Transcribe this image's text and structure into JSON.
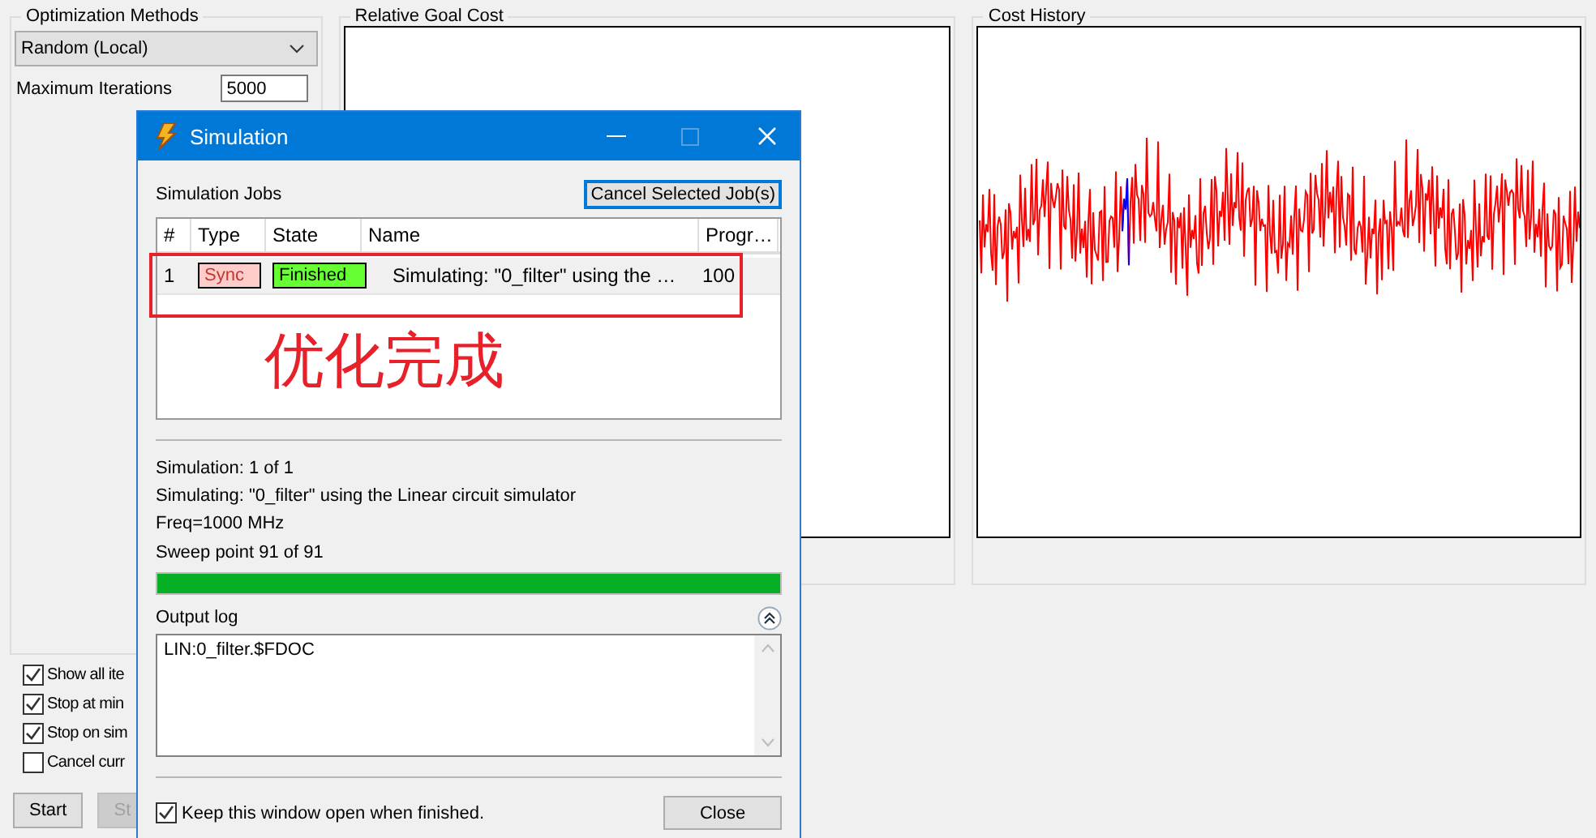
{
  "left_panel": {
    "title": "Optimization Methods",
    "method": "Random (Local)",
    "max_iterations_label": "Maximum Iterations",
    "max_iterations": "5000"
  },
  "options": [
    {
      "label": "Show all ite",
      "checked": true
    },
    {
      "label": "Stop at min",
      "checked": true
    },
    {
      "label": "Stop on sim",
      "checked": true
    },
    {
      "label": "Cancel curr",
      "checked": false
    }
  ],
  "buttons": [
    {
      "label": "Start",
      "disabled": false
    },
    {
      "label": "St",
      "disabled": true
    }
  ],
  "charts": [
    {
      "title": "Relative Goal Cost",
      "kind": "empty"
    },
    {
      "title": "Cost History",
      "kind": "trace"
    }
  ],
  "dialog": {
    "title": "Simulation",
    "jobs_label": "Simulation Jobs",
    "cancel_button": "Cancel Selected Job(s)",
    "columns": [
      "#",
      "Type",
      "State",
      "Name",
      "Progr…"
    ],
    "rows": [
      {
        "number": "1",
        "type": "Sync",
        "state": "Finished",
        "name": "Simulating: \"0_filter\" using the …",
        "progress": "100"
      }
    ],
    "annotation": "优化完成",
    "status_lines": [
      "Simulation: 1 of 1",
      "Simulating: \"0_filter\" using the Linear circuit simulator",
      "Freq=1000 MHz"
    ],
    "sweep_label": "Sweep point 91 of 91",
    "sweep": {
      "level": 1
    },
    "log_label": "Output log",
    "log_text": "LIN:0_filter.$FDOC",
    "keep_open": {
      "label": "Keep this window open when finished.",
      "checked": true
    },
    "close_button": "Close"
  }
}
